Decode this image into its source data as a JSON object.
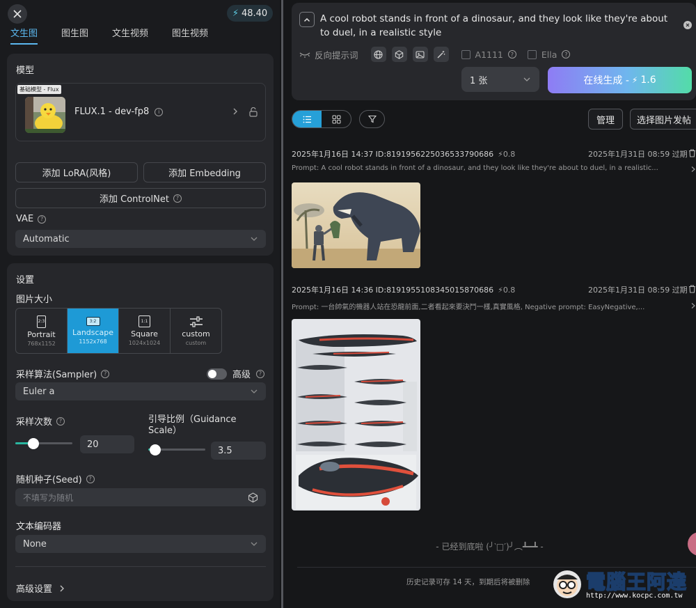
{
  "header": {
    "credits": "48.40"
  },
  "tabs": [
    "文生图",
    "图生图",
    "文生视频",
    "图生视频"
  ],
  "model_section": {
    "title": "模型",
    "tag": "基础模型 - Flux",
    "name": "FLUX.1 - dev-fp8",
    "add_lora": "添加 LoRA(风格)",
    "add_embedding": "添加 Embedding",
    "add_controlnet": "添加 ControlNet",
    "vae_label": "VAE",
    "vae_value": "Automatic"
  },
  "settings": {
    "title": "设置",
    "size_label": "图片大小",
    "sizes": [
      {
        "ratio": "2:3",
        "name": "Portrait",
        "dims": "768x1152"
      },
      {
        "ratio": "3:2",
        "name": "Landscape",
        "dims": "1152x768"
      },
      {
        "ratio": "1:1",
        "name": "Square",
        "dims": "1024x1024"
      },
      {
        "ratio": "",
        "name": "custom",
        "dims": "custom"
      }
    ],
    "selected_size": "Landscape",
    "sampler_label": "采样算法(Sampler)",
    "advanced_label": "高级",
    "advanced_on": false,
    "sampler_value": "Euler a",
    "steps_label": "采样次数",
    "steps_value": "20",
    "steps_fraction": 0.32,
    "guidance_label": "引导比例（Guidance Scale）",
    "guidance_value": "3.5",
    "guidance_fraction": 0.12,
    "seed_label": "随机种子(Seed)",
    "seed_placeholder": "不填写为随机",
    "encoder_label": "文本编码器",
    "encoder_value": "None",
    "advanced_settings": "高级设置"
  },
  "prompt": {
    "text": "A cool robot stands in front of a dinosaur, and they look like they're about to duel, in a realistic style",
    "negative_label": "反向提示词",
    "a1111_label": "A1111",
    "ella_label": "Ella",
    "count_value": "1 张",
    "generate_label": "在线生成 - ",
    "generate_cost": "1.6"
  },
  "toolbar": {
    "manage": "管理",
    "publish": "选择图片发帖"
  },
  "records": [
    {
      "time_id": "2025年1月16日 14:37 ID:819195622503653379068​6",
      "cost": "0.8",
      "expires": "2025年1月31日 08:59 过期",
      "prompt": "Prompt: A cool robot stands in front of a dinosaur, and they look like they're about to duel, in a realistic..."
    },
    {
      "time_id": "2025年1月16日 14:36 ID:8191955108345015870686",
      "cost": "0.8",
      "expires": "2025年1月31日 08:59 过期",
      "prompt": "Prompt: 一台帥氣的機器人站在恐龍前面,二者看起來要決鬥一樣,真實風格, Negative prompt: EasyNegative,..."
    }
  ],
  "end_text": "- 已经到底啦 (╯‵□′)╯︵┻━┻ -",
  "history_note": "历史记录可存 14 天，到期后将被删除",
  "watermark": {
    "title": "電腦王阿達",
    "url": "http://www.kocpc.com.tw"
  },
  "colors": {
    "accent": "#1e9ad6",
    "tab_active": "#5cb8f0",
    "slider_fill": "#2ab6a0"
  }
}
